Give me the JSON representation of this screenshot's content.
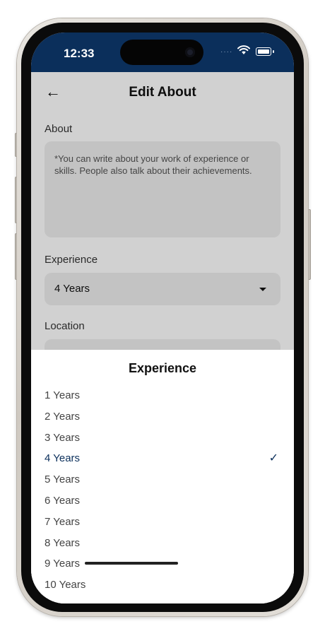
{
  "status_bar": {
    "time": "12:33"
  },
  "header": {
    "back_icon": "arrow-left-icon",
    "title": "Edit About"
  },
  "form": {
    "about_label": "About",
    "about_placeholder": "*You can write about your work of experience or skills. People also talk about their achievements.",
    "experience_label": "Experience",
    "experience_value": "4 Years",
    "location_label": "Location"
  },
  "sheet": {
    "title": "Experience",
    "options": [
      {
        "label": "1 Years"
      },
      {
        "label": "2 Years"
      },
      {
        "label": "3 Years"
      },
      {
        "label": "4 Years",
        "selected": true
      },
      {
        "label": "5 Years"
      },
      {
        "label": "6 Years"
      },
      {
        "label": "7 Years"
      },
      {
        "label": "8 Years"
      },
      {
        "label": "9 Years"
      },
      {
        "label": "10 Years"
      }
    ]
  },
  "colors": {
    "accent": "#0b2f5b",
    "field_bg": "#eeeeee"
  }
}
